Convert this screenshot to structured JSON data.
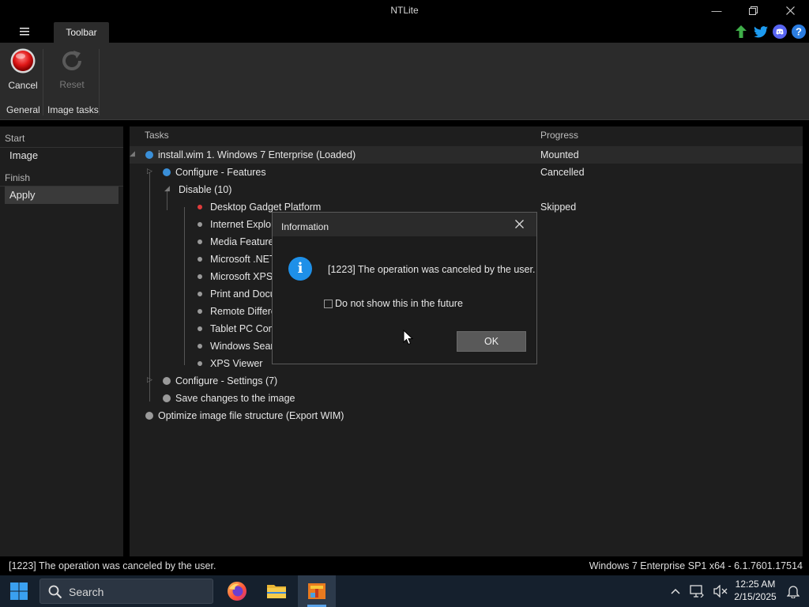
{
  "window": {
    "title": "NTLite"
  },
  "tabs": {
    "toolbar_label": "Toolbar"
  },
  "ribbon": {
    "cancel_label": "Cancel",
    "reset_label": "Reset",
    "group_general": "General",
    "group_image_tasks": "Image tasks"
  },
  "sidebar": {
    "start_header": "Start",
    "image_label": "Image",
    "finish_header": "Finish",
    "apply_label": "Apply"
  },
  "tasks": {
    "col_tasks": "Tasks",
    "col_progress": "Progress",
    "rows": [
      {
        "text": "install.wim 1. Windows 7 Enterprise  (Loaded)",
        "progress": "Mounted"
      },
      {
        "text": "Configure - Features",
        "progress": "Cancelled"
      },
      {
        "text": "Disable (10)",
        "progress": ""
      },
      {
        "text": "Desktop Gadget Platform",
        "progress": "Skipped"
      },
      {
        "text": "Internet Explorer",
        "progress": ""
      },
      {
        "text": "Media Features",
        "progress": ""
      },
      {
        "text": "Microsoft .NET",
        "progress": ""
      },
      {
        "text": "Microsoft XPS",
        "progress": ""
      },
      {
        "text": "Print and Document",
        "progress": ""
      },
      {
        "text": "Remote Differential",
        "progress": ""
      },
      {
        "text": "Tablet PC Components",
        "progress": ""
      },
      {
        "text": "Windows Search",
        "progress": ""
      },
      {
        "text": "XPS Viewer",
        "progress": ""
      },
      {
        "text": "Configure - Settings (7)",
        "progress": ""
      },
      {
        "text": "Save changes to the image",
        "progress": ""
      },
      {
        "text": "Optimize image file structure (Export WIM)",
        "progress": ""
      }
    ]
  },
  "dialog": {
    "title": "Information",
    "message": "[1223] The operation was canceled by the user.",
    "checkbox_label": "Do not show this in the future",
    "ok_label": "OK"
  },
  "status": {
    "left": "[1223] The operation was canceled by the user.",
    "right": "Windows 7 Enterprise SP1 x64 - 6.1.7601.17514"
  },
  "taskbar": {
    "search_label": "Search",
    "time": "12:25 AM",
    "date": "2/15/2025"
  },
  "colors": {
    "dot_blue": "#3a8fd8",
    "dot_red": "#e03b3b",
    "dot_gray": "#9a9a9a",
    "accent": "#1e90e8"
  }
}
